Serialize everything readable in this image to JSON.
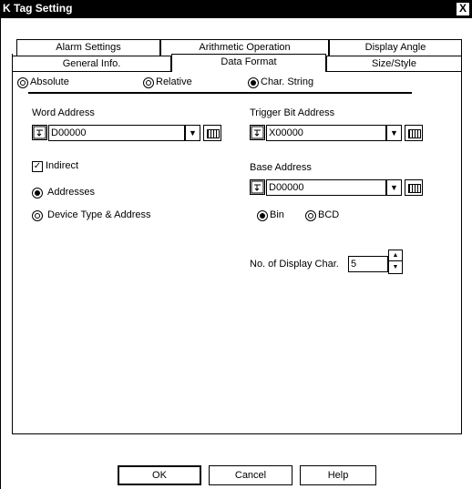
{
  "window": {
    "title": "K Tag Setting",
    "close_glyph": "X"
  },
  "tabs": {
    "row1": [
      "Alarm Settings",
      "Arithmetic Operation",
      "Display Angle"
    ],
    "row2": [
      "General Info.",
      "Data Format",
      "Size/Style"
    ],
    "active": "Data Format"
  },
  "format": {
    "absolute": "Absolute",
    "relative": "Relative",
    "char_string": "Char. String",
    "selected": "char_string"
  },
  "word_address": {
    "label": "Word Address",
    "value": "D00000"
  },
  "trigger_bit": {
    "label": "Trigger Bit Address",
    "value": "X00000"
  },
  "indirect": {
    "label": "Indirect",
    "checked": true
  },
  "mode": {
    "addresses": "Addresses",
    "device_type": "Device Type & Address",
    "selected": "addresses"
  },
  "base_address": {
    "label": "Base Address",
    "value": "D00000"
  },
  "numeric": {
    "bin": "Bin",
    "bcd": "BCD",
    "selected": "bin"
  },
  "display_chars": {
    "label": "No. of Display Char.",
    "value": "5"
  },
  "buttons": {
    "ok": "OK",
    "cancel": "Cancel",
    "help": "Help"
  },
  "icons": {
    "addr_input": "address-input-icon",
    "keypad": "keypad-icon",
    "dropdown": "chevron-down-icon"
  }
}
